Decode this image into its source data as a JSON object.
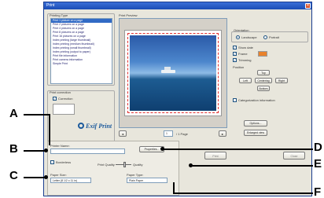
{
  "window": {
    "title": "Print"
  },
  "printing_type": {
    "label": "Printing Type",
    "items": [
      "Print 1 picture on a page",
      "Print 2 pictures on a page",
      "Print 4 pictures on a page",
      "Print 8 pictures on a page",
      "Print 16 pictures on a page",
      "Index printing (large thumbnail)",
      "Index printing (medium thumbnail)",
      "Index printing (small thumbnail)",
      "Index printing (output to paper)",
      "Print file information",
      "Print camera information",
      "Simple Print"
    ]
  },
  "print_preview": {
    "label": "Print Preview",
    "page": "1",
    "page_total": "/ 1 Page"
  },
  "orientation": {
    "label": "Orientation",
    "landscape": "Landscape",
    "portrait": "Portrait"
  },
  "options": {
    "show_date": "Show date",
    "frame": "Frame",
    "trimming": "Trimming"
  },
  "position": {
    "label": "Position",
    "top": "Top",
    "left": "Left",
    "center": "Centering",
    "right": "Right",
    "bottom": "Bottom"
  },
  "categorization": "Categorization information",
  "print_correction": {
    "label": "Print correction",
    "correction": "Correction"
  },
  "logo": {
    "text": "Exif Print"
  },
  "buttons": {
    "options": "Options...",
    "enlarged": "Enlarged view",
    "properties": "Properties...",
    "print": "Print",
    "close": "Close"
  },
  "printer_name": {
    "label": "Printer Name:",
    "value": ""
  },
  "borderless": {
    "label": "Borderless"
  },
  "print_quality": {
    "label": "Print Quality",
    "value": "Quality"
  },
  "paper_size": {
    "label": "Paper Size:",
    "value": "Letter (8 1/2 x 11 in)"
  },
  "paper_type": {
    "label": "Paper Type:",
    "value": "Plain Paper"
  },
  "callouts": {
    "a": "A",
    "b": "B",
    "c": "C",
    "d": "D",
    "e": "E",
    "f": "F"
  }
}
